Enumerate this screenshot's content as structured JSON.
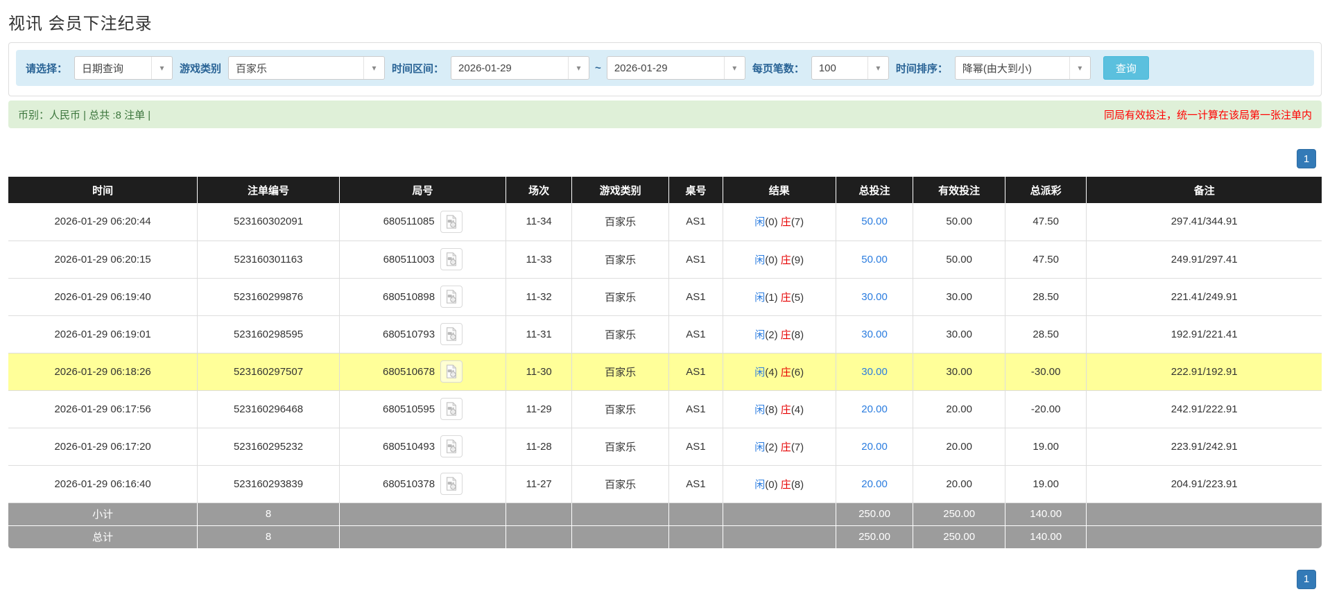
{
  "page_title": "视讯 会员下注纪录",
  "filters": {
    "select_label": "请选择：",
    "select_value": "日期查询",
    "game_type_label": "游戏类别",
    "game_type_value": "百家乐",
    "time_range_label": "时间区间：",
    "time_from": "2026-01-29",
    "range_separator": "~",
    "time_to": "2026-01-29",
    "page_size_label": "每页笔数：",
    "page_size_value": "100",
    "sort_label": "时间排序：",
    "sort_value": "降幂(由大到小)",
    "query_button": "查询"
  },
  "notice": {
    "summary": "币别：人民币 | 总共 :8 注单 |",
    "warning": "同局有效投注，统一计算在该局第一张注单内"
  },
  "pagination": {
    "page": "1"
  },
  "icons": {
    "select_arrow": "▾",
    "video_icon": "video-file-icon"
  },
  "colors": {
    "accent_blue": "#337ab7",
    "info_bar": "#d9edf7",
    "info_button": "#5bc0de",
    "success_bg": "#dff0d8",
    "success_text": "#3c763d",
    "warning_text": "#ff0000",
    "highlight_row": "#ffff99",
    "header_bg": "#1e1e1e",
    "summary_bg": "#9c9c9c",
    "link_blue": "#2a7cdf",
    "banker_red": "#e60000"
  },
  "table": {
    "headers": [
      "时间",
      "注单编号",
      "局号",
      "场次",
      "游戏类别",
      "桌号",
      "结果",
      "总投注",
      "有效投注",
      "总派彩",
      "备注"
    ],
    "result_labels": {
      "player": "闲",
      "banker": "庄"
    },
    "rows": [
      {
        "time": "2026-01-29 06:20:44",
        "bet_id": "523160302091",
        "round_id": "680511085",
        "session": "11-34",
        "game": "百家乐",
        "table_no": "AS1",
        "player": "0",
        "banker": "7",
        "total_bet": "50.00",
        "valid_bet": "50.00",
        "payout": "47.50",
        "remark": "297.41/344.91",
        "highlight": false
      },
      {
        "time": "2026-01-29 06:20:15",
        "bet_id": "523160301163",
        "round_id": "680511003",
        "session": "11-33",
        "game": "百家乐",
        "table_no": "AS1",
        "player": "0",
        "banker": "9",
        "total_bet": "50.00",
        "valid_bet": "50.00",
        "payout": "47.50",
        "remark": "249.91/297.41",
        "highlight": false
      },
      {
        "time": "2026-01-29 06:19:40",
        "bet_id": "523160299876",
        "round_id": "680510898",
        "session": "11-32",
        "game": "百家乐",
        "table_no": "AS1",
        "player": "1",
        "banker": "5",
        "total_bet": "30.00",
        "valid_bet": "30.00",
        "payout": "28.50",
        "remark": "221.41/249.91",
        "highlight": false
      },
      {
        "time": "2026-01-29 06:19:01",
        "bet_id": "523160298595",
        "round_id": "680510793",
        "session": "11-31",
        "game": "百家乐",
        "table_no": "AS1",
        "player": "2",
        "banker": "8",
        "total_bet": "30.00",
        "valid_bet": "30.00",
        "payout": "28.50",
        "remark": "192.91/221.41",
        "highlight": false
      },
      {
        "time": "2026-01-29 06:18:26",
        "bet_id": "523160297507",
        "round_id": "680510678",
        "session": "11-30",
        "game": "百家乐",
        "table_no": "AS1",
        "player": "4",
        "banker": "6",
        "total_bet": "30.00",
        "valid_bet": "30.00",
        "payout": "-30.00",
        "remark": "222.91/192.91",
        "highlight": true
      },
      {
        "time": "2026-01-29 06:17:56",
        "bet_id": "523160296468",
        "round_id": "680510595",
        "session": "11-29",
        "game": "百家乐",
        "table_no": "AS1",
        "player": "8",
        "banker": "4",
        "total_bet": "20.00",
        "valid_bet": "20.00",
        "payout": "-20.00",
        "remark": "242.91/222.91",
        "highlight": false
      },
      {
        "time": "2026-01-29 06:17:20",
        "bet_id": "523160295232",
        "round_id": "680510493",
        "session": "11-28",
        "game": "百家乐",
        "table_no": "AS1",
        "player": "2",
        "banker": "7",
        "total_bet": "20.00",
        "valid_bet": "20.00",
        "payout": "19.00",
        "remark": "223.91/242.91",
        "highlight": false
      },
      {
        "time": "2026-01-29 06:16:40",
        "bet_id": "523160293839",
        "round_id": "680510378",
        "session": "11-27",
        "game": "百家乐",
        "table_no": "AS1",
        "player": "0",
        "banker": "8",
        "total_bet": "20.00",
        "valid_bet": "20.00",
        "payout": "19.00",
        "remark": "204.91/223.91",
        "highlight": false
      }
    ],
    "summary_rows": [
      {
        "label": "小计",
        "count": "8",
        "total_bet": "250.00",
        "valid_bet": "250.00",
        "payout": "140.00"
      },
      {
        "label": "总计",
        "count": "8",
        "total_bet": "250.00",
        "valid_bet": "250.00",
        "payout": "140.00"
      }
    ]
  }
}
